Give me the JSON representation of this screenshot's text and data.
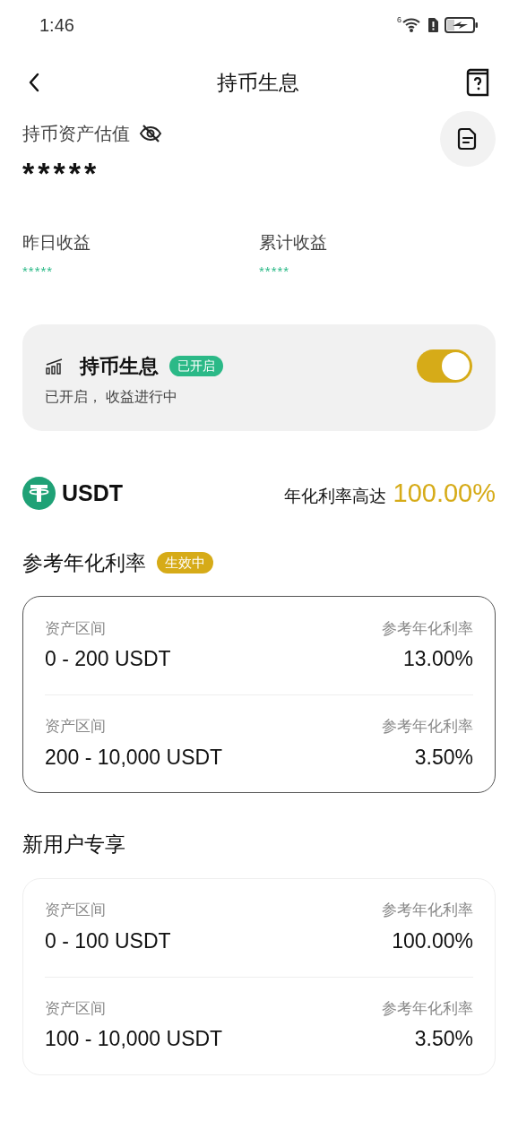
{
  "status_bar": {
    "time": "1:46",
    "network": "6"
  },
  "header": {
    "title": "持币生息"
  },
  "assets": {
    "label": "持币资产估值",
    "value": "*****"
  },
  "earnings": [
    {
      "label": "昨日收益",
      "value": "*****"
    },
    {
      "label": "累计收益",
      "value": "*****"
    }
  ],
  "feature_card": {
    "title": "持币生息",
    "badge": "已开启",
    "subtitle": "已开启， 收益进行中",
    "on": true
  },
  "coin": {
    "name": "USDT",
    "rate_label": "年化利率高达",
    "rate": "100.00%"
  },
  "sections": [
    {
      "title": "参考年化利率",
      "badge": "生效中",
      "emphasized": true,
      "rows": [
        {
          "range_label": "资产区间",
          "range": "0 - 200 USDT",
          "rate_label": "参考年化利率",
          "rate": "13.00%"
        },
        {
          "range_label": "资产区间",
          "range": "200 - 10,000 USDT",
          "rate_label": "参考年化利率",
          "rate": "3.50%"
        }
      ]
    },
    {
      "title": "新用户专享",
      "emphasized": false,
      "rows": [
        {
          "range_label": "资产区间",
          "range": "0 - 100 USDT",
          "rate_label": "参考年化利率",
          "rate": "100.00%"
        },
        {
          "range_label": "资产区间",
          "range": "100 - 10,000 USDT",
          "rate_label": "参考年化利率",
          "rate": "3.50%"
        }
      ]
    }
  ]
}
